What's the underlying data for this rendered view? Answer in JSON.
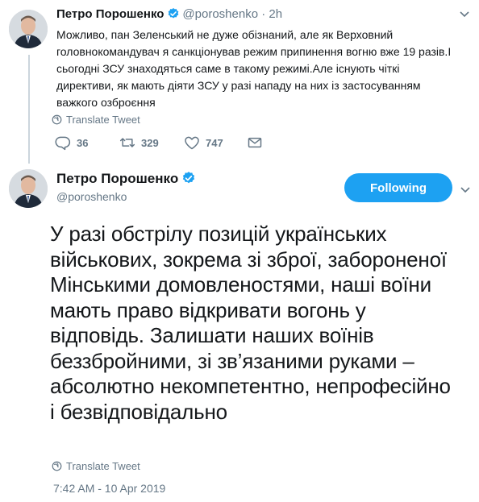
{
  "reply_tweet": {
    "author_name": "Петро Порошенко",
    "handle": "@poroshenko",
    "separator": "·",
    "time_ago": "2h",
    "text": "Можливо, пан Зеленський не дуже обізнаний, але як Верховний головнокомандувач я санкціонував режим припинення вогню вже 19 разів.І сьогодні ЗСУ знаходяться саме в такому режимі.Але існують чіткі директиви, як мають діяти ЗСУ у разі нападу на них із застосуванням важкого озброєння",
    "translate_label": "Translate Tweet",
    "replies": "36",
    "retweets": "329",
    "likes": "747",
    "icons": [
      "globe-icon",
      "reply-icon",
      "retweet-icon",
      "like-icon",
      "dm-icon",
      "chevron-down-icon",
      "verified-badge-icon"
    ]
  },
  "main_tweet": {
    "author_name": "Петро Порошенко",
    "handle": "@poroshenko",
    "follow_label": "Following",
    "text": "У разі обстрілу позицій українських військових, зокрема зі зброї, забороненої Мінськими домовленостями, наші воїни мають право відкривати вогонь у відповідь. Залишати наших воїнів беззбройними, зі зв’язаними руками – абсолютно некомпетентно, непрофесійно і безвідповідально",
    "translate_label": "Translate Tweet",
    "timestamp": "7:42 AM - 10 Apr 2019"
  },
  "colors": {
    "accent": "#1da1f2",
    "muted": "#657786",
    "text": "#14171a",
    "thread_line": "#ccd6dd"
  }
}
